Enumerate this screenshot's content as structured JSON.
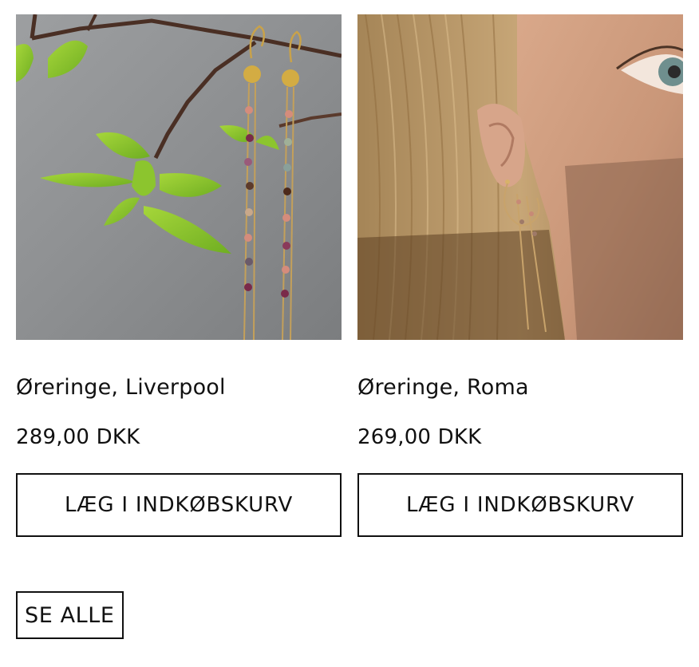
{
  "products": [
    {
      "title": "Øreringe, Liverpool",
      "price": "289,00 DKK",
      "button_label": "LÆG I INDKØBSKURV",
      "image_alt": "Øreringe, Liverpool"
    },
    {
      "title": "Øreringe, Roma",
      "price": "269,00 DKK",
      "button_label": "LÆG I INDKØBSKURV",
      "image_alt": "Øreringe, Roma"
    }
  ],
  "see_all_label": "SE ALLE",
  "colors": {
    "text": "#111111",
    "border": "#111111",
    "background": "#ffffff"
  }
}
